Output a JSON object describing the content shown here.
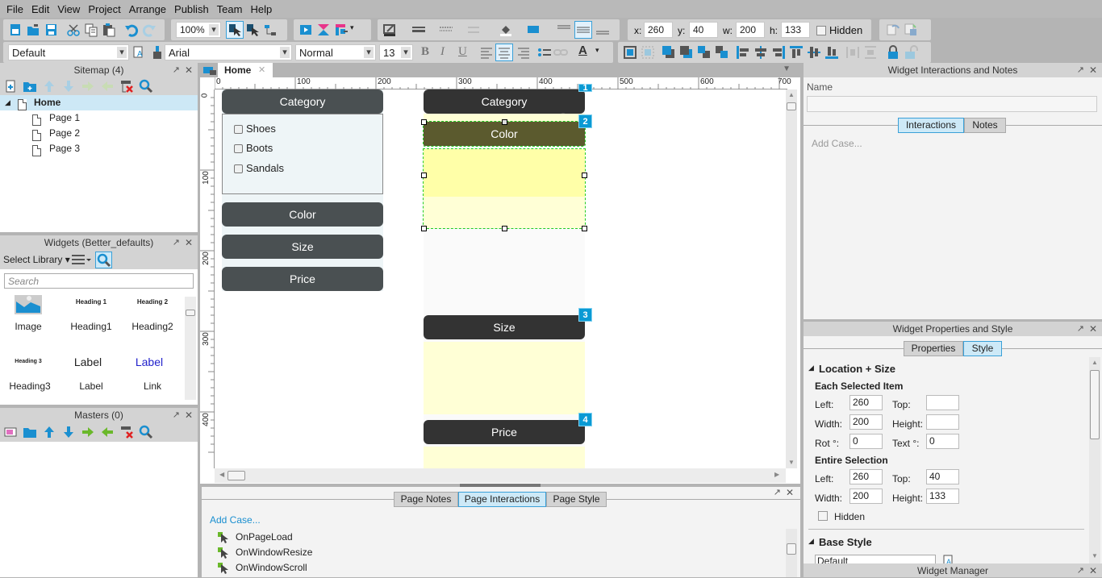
{
  "menu": [
    "File",
    "Edit",
    "View",
    "Project",
    "Arrange",
    "Publish",
    "Team",
    "Help"
  ],
  "toolbar": {
    "zoom": "100%",
    "x_label": "x:",
    "x": "260",
    "y_label": "y:",
    "y": "40",
    "w_label": "w:",
    "w": "200",
    "h_label": "h:",
    "h": "133",
    "hidden_label": "Hidden",
    "style": "Default",
    "font": "Arial",
    "weight": "Normal",
    "size": "13",
    "bold": "B",
    "italic": "I",
    "underline": "U",
    "font_color_glyph": "A"
  },
  "sitemap": {
    "title": "Sitemap (4)",
    "root": "Home",
    "pages": [
      "Page 1",
      "Page 2",
      "Page 3"
    ]
  },
  "widgets": {
    "title": "Widgets (Better_defaults)",
    "select_library": "Select Library",
    "search_placeholder": "Search",
    "items": [
      {
        "preview": "",
        "label": "Image"
      },
      {
        "preview": "Heading 1",
        "label": "Heading1"
      },
      {
        "preview": "Heading 2",
        "label": "Heading2"
      },
      {
        "preview": "Heading 3",
        "label": "Heading3"
      },
      {
        "preview": "Label",
        "label": "Label"
      },
      {
        "preview": "Label",
        "label": "Link"
      }
    ]
  },
  "masters": {
    "title": "Masters (0)"
  },
  "canvas": {
    "tab": "Home",
    "ruler_h": [
      "0",
      "100",
      "200",
      "300",
      "400",
      "500",
      "600",
      "700"
    ],
    "ruler_v": [
      "0",
      "100",
      "200",
      "300",
      "400"
    ],
    "left_accordion": {
      "category": "Category",
      "options": [
        "Shoes",
        "Boots",
        "Sandals"
      ],
      "color": "Color",
      "size": "Size",
      "price": "Price"
    },
    "right_accordion": {
      "category": "Category",
      "color": "Color",
      "size": "Size",
      "price": "Price",
      "badges": [
        "1",
        "2",
        "3",
        "4"
      ]
    }
  },
  "page_panel": {
    "tabs": [
      "Page Notes",
      "Page Interactions",
      "Page Style"
    ],
    "active_tab": "Page Interactions",
    "add_case": "Add Case...",
    "events": [
      "OnPageLoad",
      "OnWindowResize",
      "OnWindowScroll"
    ]
  },
  "interactions_panel": {
    "title": "Widget Interactions and Notes",
    "name_label": "Name",
    "name_value": "",
    "tabs": [
      "Interactions",
      "Notes"
    ],
    "active_tab": "Interactions",
    "add_case": "Add Case..."
  },
  "properties_panel": {
    "title": "Widget Properties and Style",
    "tabs": [
      "Properties",
      "Style"
    ],
    "active_tab": "Style",
    "location_size": "Location + Size",
    "each_selected": "Each Selected Item",
    "each": {
      "left_label": "Left:",
      "left": "260",
      "top_label": "Top:",
      "top": "",
      "width_label": "Width:",
      "width": "200",
      "height_label": "Height:",
      "height": "",
      "rot_label": "Rot °:",
      "rot": "0",
      "text_label": "Text °:",
      "text": "0"
    },
    "entire_selection": "Entire Selection",
    "entire": {
      "left_label": "Left:",
      "left": "260",
      "top_label": "Top:",
      "top": "40",
      "width_label": "Width:",
      "width": "200",
      "height_label": "Height:",
      "height": "133"
    },
    "hidden_label": "Hidden",
    "base_style": "Base Style",
    "base_style_value": "Default"
  },
  "widget_manager": {
    "title": "Widget Manager"
  },
  "colors": {
    "accent": "#0a9ad4",
    "accordion_dark": "#4a5052",
    "accordion_darker": "#333333",
    "color_header": "#5b5a2e",
    "yellow_panel": "#ffffa8",
    "yellow_light": "#ffffd6",
    "selection": "#22cc22"
  }
}
